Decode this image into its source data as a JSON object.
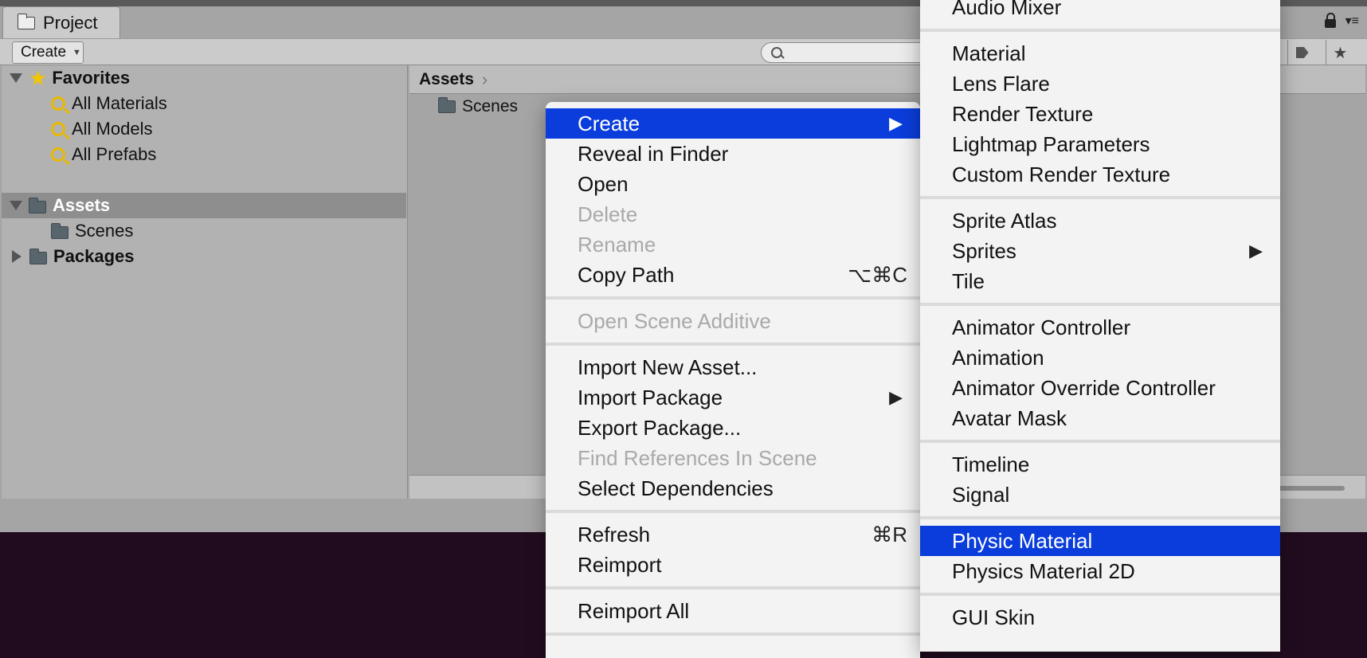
{
  "window": {
    "tab_title": "Project"
  },
  "toolbar": {
    "create_label": "Create"
  },
  "tree": {
    "favorites_label": "Favorites",
    "favorites": [
      "All Materials",
      "All Models",
      "All Prefabs"
    ],
    "assets_label": "Assets",
    "assets_children": [
      "Scenes"
    ],
    "packages_label": "Packages"
  },
  "browser": {
    "breadcrumb": "Assets",
    "items": [
      "Scenes"
    ]
  },
  "context_menu": {
    "items": [
      {
        "label": "Create",
        "state": "highlighted",
        "submenu": true
      },
      {
        "label": "Reveal in Finder"
      },
      {
        "label": "Open"
      },
      {
        "label": "Delete",
        "state": "disabled"
      },
      {
        "label": "Rename",
        "state": "disabled"
      },
      {
        "label": "Copy Path",
        "shortcut": "⌥⌘C"
      },
      {
        "label": "Open Scene Additive",
        "state": "disabled"
      },
      {
        "label": "Import New Asset..."
      },
      {
        "label": "Import Package",
        "submenu": true
      },
      {
        "label": "Export Package..."
      },
      {
        "label": "Find References In Scene",
        "state": "disabled"
      },
      {
        "label": "Select Dependencies"
      },
      {
        "label": "Refresh",
        "shortcut": "⌘R"
      },
      {
        "label": "Reimport"
      },
      {
        "label": "Reimport All"
      }
    ]
  },
  "create_submenu": {
    "items": [
      {
        "label": "Audio Mixer"
      },
      {
        "label": "Material"
      },
      {
        "label": "Lens Flare"
      },
      {
        "label": "Render Texture"
      },
      {
        "label": "Lightmap Parameters"
      },
      {
        "label": "Custom Render Texture"
      },
      {
        "label": "Sprite Atlas"
      },
      {
        "label": "Sprites",
        "submenu": true
      },
      {
        "label": "Tile"
      },
      {
        "label": "Animator Controller"
      },
      {
        "label": "Animation"
      },
      {
        "label": "Animator Override Controller"
      },
      {
        "label": "Avatar Mask"
      },
      {
        "label": "Timeline"
      },
      {
        "label": "Signal"
      },
      {
        "label": "Physic Material",
        "state": "highlighted"
      },
      {
        "label": "Physics Material 2D"
      },
      {
        "label": "GUI Skin"
      }
    ]
  },
  "glyphs": {
    "submenu_arrow": "▶",
    "star": "★",
    "menu_dots": "▾≡"
  },
  "colors": {
    "highlight": "#0a3ddb",
    "background": "#210c1f"
  }
}
